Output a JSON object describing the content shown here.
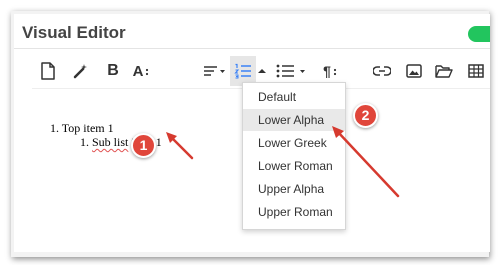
{
  "window": {
    "title": "Visual Editor"
  },
  "toolbar": {
    "tools": [
      {
        "icon": "new-document-icon"
      },
      {
        "icon": "magic-wand-icon"
      },
      {
        "icon": "bold-icon",
        "label": "B"
      },
      {
        "icon": "font-size-icon",
        "label": "A"
      },
      {
        "icon": "align-icon"
      },
      {
        "icon": "numbered-list-icon",
        "active": true
      },
      {
        "icon": "bullet-list-icon"
      },
      {
        "icon": "paragraph-icon",
        "label": "¶"
      },
      {
        "icon": "link-icon"
      },
      {
        "icon": "image-icon"
      },
      {
        "icon": "folder-icon"
      },
      {
        "icon": "table-icon"
      }
    ]
  },
  "editor": {
    "items": [
      {
        "marker": "1.",
        "text": "Top item 1"
      },
      {
        "marker": "1.",
        "text_underlined": "Sub list",
        "text_rest": " item 1"
      }
    ]
  },
  "list_style_menu": {
    "options": [
      "Default",
      "Lower Alpha",
      "Lower Greek",
      "Lower Roman",
      "Upper Alpha",
      "Upper Roman"
    ],
    "selected": "Lower Alpha"
  },
  "callouts": [
    "1",
    "2"
  ],
  "colors": {
    "accent_toggle": "#22c55e",
    "callout": "#e0463b",
    "arrow": "#d63a2f"
  }
}
